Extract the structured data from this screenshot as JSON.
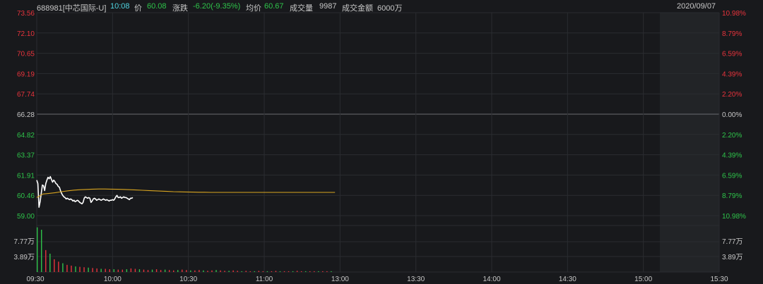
{
  "header": {
    "symbol": "688981[中芯国际-U]",
    "time": "10:08",
    "price_label": "价",
    "price": "60.08",
    "change_label": "涨跌",
    "change": "-6.20(-9.35%)",
    "avg_label": "均价",
    "avg": "60.67",
    "volume_label": "成交量",
    "volume": "9987",
    "amount_label": "成交金额",
    "amount": "6000万",
    "date": "2020/09/07"
  },
  "colors": {
    "up": "#e8333c",
    "down": "#2ec44a",
    "price_line": "#ffffff",
    "avg_line": "#d9a520",
    "grid": "#2a2c30",
    "base": "#6a6c70",
    "cyan": "#4fd3e0"
  },
  "chart_data": {
    "type": "line",
    "x_ticks": [
      "09:30",
      "10:00",
      "10:30",
      "11:00",
      "13:00",
      "13:30",
      "14:00",
      "14:30",
      "15:00",
      "15:30"
    ],
    "price_levels": [
      "73.56",
      "72.10",
      "70.65",
      "69.19",
      "67.74",
      "66.28",
      "64.82",
      "63.37",
      "61.91",
      "60.46",
      "59.00"
    ],
    "pct_levels": [
      "10.98%",
      "8.79%",
      "6.59%",
      "4.39%",
      "2.20%",
      "0.00%",
      "2.20%",
      "4.39%",
      "6.59%",
      "8.79%",
      "10.98%"
    ],
    "pct_colors": [
      "up",
      "up",
      "up",
      "up",
      "up",
      "neutral",
      "down",
      "down",
      "down",
      "down",
      "down"
    ],
    "ylim": [
      59.0,
      73.56
    ],
    "prev_close": 66.28,
    "volume_ticks": [
      "7.77万",
      "3.89万"
    ],
    "volume_ylim": [
      0,
      11.66
    ],
    "series": [
      {
        "name": "价",
        "values": [
          61.55,
          61.3,
          59.6,
          60.0,
          60.6,
          61.2,
          61.15,
          60.8,
          61.3,
          61.55,
          61.75,
          61.65,
          61.8,
          61.6,
          61.4,
          61.55,
          61.45,
          61.3,
          61.25,
          61.1,
          61.05,
          60.8,
          60.6,
          60.45,
          60.35,
          60.3,
          60.2,
          60.25,
          60.2,
          60.15,
          60.2,
          60.15,
          60.05,
          60.1,
          60.0,
          60.05,
          60.1,
          60.05,
          59.95,
          59.9,
          59.85,
          59.95,
          60.25,
          60.35,
          60.3,
          60.25,
          60.3,
          60.25,
          59.95,
          60.05,
          60.2,
          60.25,
          60.2,
          60.1,
          60.15,
          60.2,
          60.15,
          60.1,
          60.15,
          60.2,
          60.15,
          60.1,
          60.15,
          60.1,
          60.05,
          60.1,
          60.1,
          60.15,
          60.1,
          60.2,
          60.35,
          60.45,
          60.3,
          60.3,
          60.35,
          60.25,
          60.3,
          60.35,
          60.3,
          60.3,
          60.25,
          60.2,
          60.15,
          60.25,
          60.25,
          60.3
        ]
      },
      {
        "name": "均价",
        "values": [
          60.3,
          60.55,
          60.6,
          60.65,
          60.72,
          60.78,
          60.83,
          60.86,
          60.88,
          60.9,
          60.91,
          60.91,
          60.9,
          60.89,
          60.88,
          60.86,
          60.84,
          60.82,
          60.8,
          60.78,
          60.76,
          60.74,
          60.72,
          60.71,
          60.7,
          60.69,
          60.68,
          60.68,
          60.67,
          60.67,
          60.67,
          60.67,
          60.67,
          60.67,
          60.67,
          60.67,
          60.67,
          60.67,
          60.67,
          60.67,
          60.67,
          60.67,
          60.67,
          60.67,
          60.67,
          60.67,
          60.67,
          60.67,
          60.67
        ]
      }
    ],
    "volume": [
      11.2,
      10.6,
      5.5,
      4.6,
      3.2,
      2.6,
      2.2,
      1.8,
      1.6,
      1.4,
      1.3,
      1.2,
      1.1,
      1.0,
      0.9,
      0.8,
      0.8,
      0.7,
      0.7,
      0.6,
      0.6,
      0.7,
      0.9,
      0.8,
      0.7,
      0.6,
      0.5,
      0.6,
      0.7,
      0.5,
      0.6,
      0.5,
      0.4,
      0.5,
      0.6,
      0.5,
      0.4,
      0.4,
      0.5,
      0.4,
      0.3,
      0.4,
      0.5,
      0.4,
      0.3,
      0.3,
      0.4,
      0.3,
      0.2,
      0.3,
      0.2,
      0.2,
      0.3,
      0.2,
      0.2,
      0.2,
      0.3,
      0.2,
      0.2,
      0.2,
      0.2,
      0.3,
      0.2,
      0.2,
      0.2,
      0.2,
      0.2,
      0.2,
      0.2,
      0.2
    ],
    "grid": true
  }
}
